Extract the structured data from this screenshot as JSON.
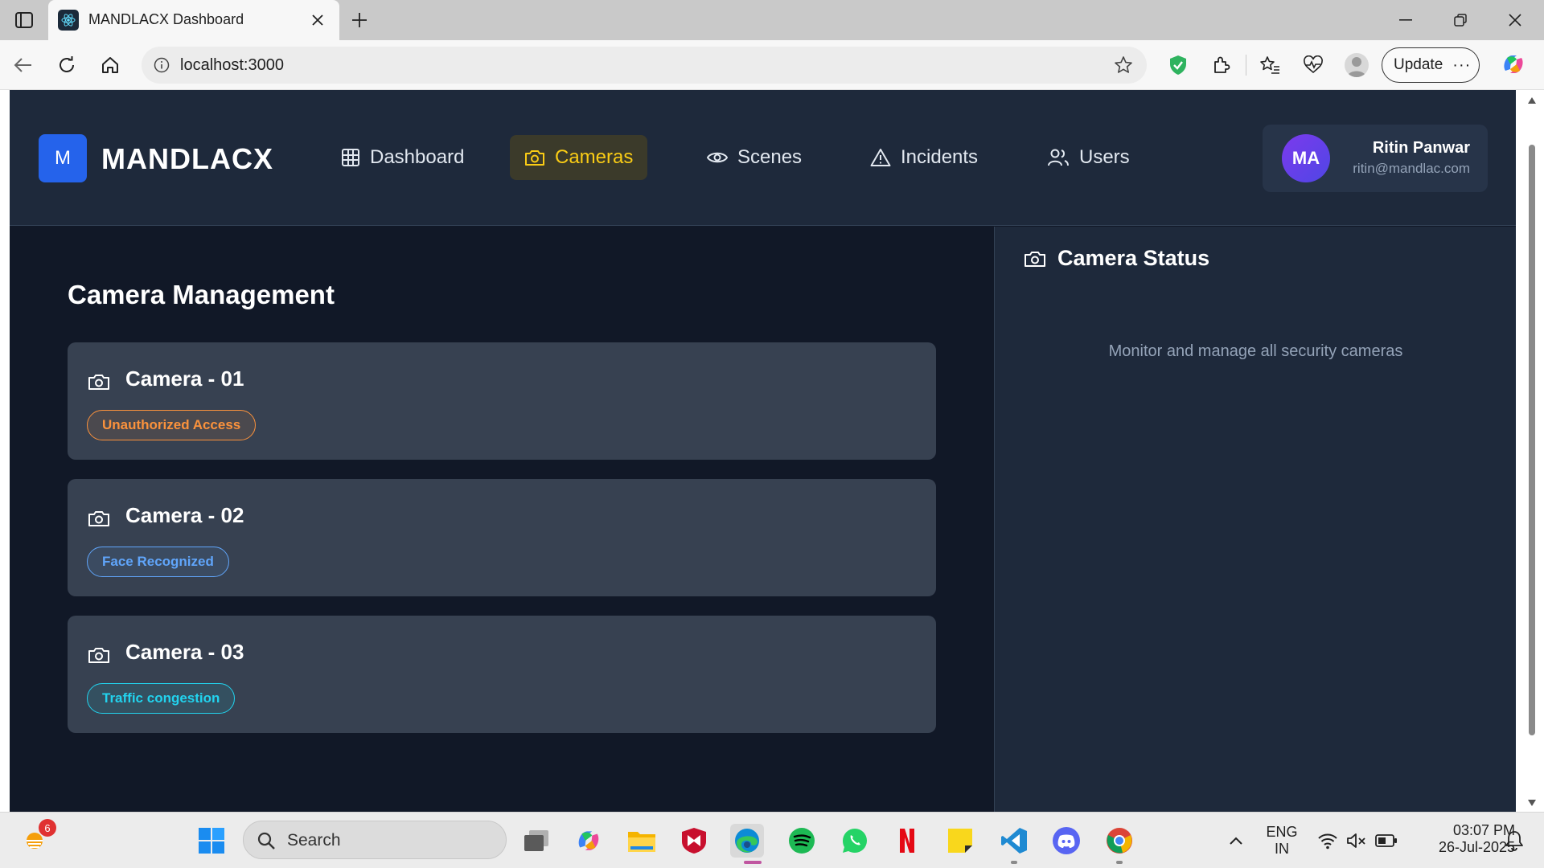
{
  "browser": {
    "tab_title": "MANDLACX Dashboard",
    "address": "localhost:3000",
    "update_label": "Update",
    "update_more": "···"
  },
  "app": {
    "logo_letter": "M",
    "brand": "MANDLACX",
    "nav": [
      {
        "label": "Dashboard",
        "icon": "grid-icon",
        "active": false
      },
      {
        "label": "Cameras",
        "icon": "camera-icon",
        "active": true
      },
      {
        "label": "Scenes",
        "icon": "eye-icon",
        "active": false
      },
      {
        "label": "Incidents",
        "icon": "warning-triangle-icon",
        "active": false
      },
      {
        "label": "Users",
        "icon": "users-icon",
        "active": false
      }
    ],
    "user": {
      "initials": "MA",
      "name": "Ritin Panwar",
      "email": "ritin@mandlac.com"
    }
  },
  "main": {
    "title": "Camera Management",
    "cameras": [
      {
        "name": "Camera - 01",
        "status": "Unauthorized Access",
        "status_color": "#fb923c"
      },
      {
        "name": "Camera - 02",
        "status": "Face Recognized",
        "status_color": "#60a5fa"
      },
      {
        "name": "Camera - 03",
        "status": "Traffic congestion",
        "status_color": "#22d3ee"
      }
    ]
  },
  "sidebar": {
    "title": "Camera Status",
    "description": "Monitor and manage all security cameras"
  },
  "taskbar": {
    "widget_badge": "6",
    "search_label": "Search",
    "lang_line1": "ENG",
    "lang_line2": "IN",
    "time": "03:07 PM",
    "date": "26-Jul-2025"
  },
  "colors": {
    "accent": "#facc15",
    "logo": "#2563eb",
    "bg": "#111827",
    "panel": "#1e293b",
    "card": "#374151"
  }
}
